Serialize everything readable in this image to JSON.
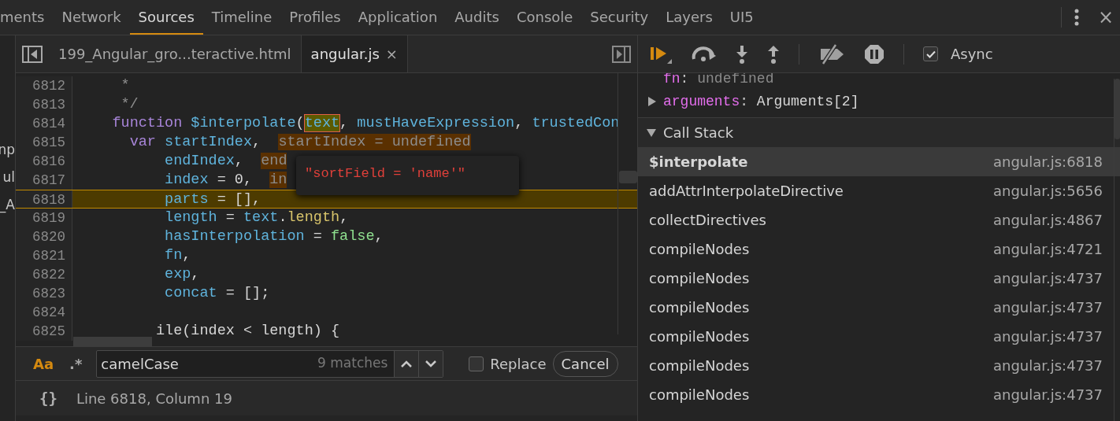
{
  "main_tabs": [
    {
      "label": "ments",
      "selected": false
    },
    {
      "label": "Network",
      "selected": false
    },
    {
      "label": "Sources",
      "selected": true
    },
    {
      "label": "Timeline",
      "selected": false
    },
    {
      "label": "Profiles",
      "selected": false
    },
    {
      "label": "Application",
      "selected": false
    },
    {
      "label": "Audits",
      "selected": false
    },
    {
      "label": "Console",
      "selected": false
    },
    {
      "label": "Security",
      "selected": false
    },
    {
      "label": "Layers",
      "selected": false
    },
    {
      "label": "UI5",
      "selected": false
    }
  ],
  "close_glyph": "×",
  "navigator_fragments": [
    "np",
    "ul",
    "_A"
  ],
  "file_tabs": [
    {
      "label": "199_Angular_gro...teractive.html",
      "selected": false,
      "closable": false
    },
    {
      "label": "angular.js",
      "selected": true,
      "closable": true,
      "close": "×"
    }
  ],
  "code_lines": [
    {
      "number": "6812",
      "current": false,
      "tokens": [
        {
          "kind": "comment",
          "text": "     *"
        }
      ]
    },
    {
      "number": "6813",
      "current": false,
      "tokens": [
        {
          "kind": "comment",
          "text": "     */"
        }
      ]
    },
    {
      "number": "6814",
      "current": false,
      "tokens": [
        {
          "kind": "keyword",
          "text": "    function "
        },
        {
          "kind": "ident",
          "text": "$interpolate"
        },
        {
          "kind": "plain",
          "text": "("
        },
        {
          "kind": "match",
          "text": "text"
        },
        {
          "kind": "plain",
          "text": ", "
        },
        {
          "kind": "ident",
          "text": "mustHaveExpression"
        },
        {
          "kind": "plain",
          "text": ", "
        },
        {
          "kind": "ident",
          "text": "trustedCon"
        }
      ]
    },
    {
      "number": "6815",
      "current": false,
      "tokens": [
        {
          "kind": "keyword",
          "text": "      var "
        },
        {
          "kind": "ident",
          "text": "startIndex"
        },
        {
          "kind": "plain",
          "text": ",  "
        },
        {
          "kind": "hint",
          "text": "startIndex = undefined"
        }
      ]
    },
    {
      "number": "6816",
      "current": false,
      "tokens": [
        {
          "kind": "ident",
          "text": "          endIndex"
        },
        {
          "kind": "plain",
          "text": ",  "
        },
        {
          "kind": "hint",
          "text": "end"
        }
      ]
    },
    {
      "number": "6817",
      "current": false,
      "tokens": [
        {
          "kind": "ident",
          "text": "          index"
        },
        {
          "kind": "plain",
          "text": " = 0,  "
        },
        {
          "kind": "hint",
          "text": "in"
        }
      ]
    },
    {
      "number": "6818",
      "current": true,
      "tokens": [
        {
          "kind": "ident",
          "text": "          parts"
        },
        {
          "kind": "plain",
          "text": " = [],"
        }
      ]
    },
    {
      "number": "6819",
      "current": false,
      "tokens": [
        {
          "kind": "ident",
          "text": "          length"
        },
        {
          "kind": "plain",
          "text": " = "
        },
        {
          "kind": "ident",
          "text": "text"
        },
        {
          "kind": "plain",
          "text": "."
        },
        {
          "kind": "property",
          "text": "length"
        },
        {
          "kind": "plain",
          "text": ","
        }
      ]
    },
    {
      "number": "6820",
      "current": false,
      "tokens": [
        {
          "kind": "ident",
          "text": "          hasInterpolation"
        },
        {
          "kind": "plain",
          "text": " = "
        },
        {
          "kind": "literal",
          "text": "false"
        },
        {
          "kind": "plain",
          "text": ","
        }
      ]
    },
    {
      "number": "6821",
      "current": false,
      "tokens": [
        {
          "kind": "ident",
          "text": "          fn"
        },
        {
          "kind": "plain",
          "text": ","
        }
      ]
    },
    {
      "number": "6822",
      "current": false,
      "tokens": [
        {
          "kind": "ident",
          "text": "          exp"
        },
        {
          "kind": "plain",
          "text": ","
        }
      ]
    },
    {
      "number": "6823",
      "current": false,
      "tokens": [
        {
          "kind": "ident",
          "text": "          concat"
        },
        {
          "kind": "plain",
          "text": " = [];"
        }
      ]
    },
    {
      "number": "6824",
      "current": false
    },
    {
      "number": "6825",
      "current": false,
      "tokens": [
        {
          "kind": "plain",
          "text": "         ile(index < length) {"
        }
      ]
    }
  ],
  "tooltip": {
    "text": "\"sortField = 'name'\""
  },
  "search": {
    "case_label": "Aa",
    "case_on": true,
    "regex_label": ".*",
    "regex_on": false,
    "value": "camelCase",
    "matches": "9 matches",
    "replace_label": "Replace",
    "replace_checked": false,
    "cancel": "Cancel"
  },
  "status_bar": {
    "pretty": "{}",
    "position": "Line 6818, Column 19"
  },
  "debug_toolbar": {
    "async_label": "Async",
    "async_checked": true
  },
  "scope": [
    {
      "name": "fn",
      "colon": ":",
      "value": "undefined",
      "kind": "undefined"
    },
    {
      "name": "arguments",
      "colon": ":",
      "value": "Arguments[2]",
      "kind": "object",
      "expanded": false
    }
  ],
  "call_stack": {
    "title": "Call Stack",
    "expanded": true,
    "frames": [
      {
        "name": "$interpolate",
        "location": "angular.js:6818",
        "selected": true
      },
      {
        "name": "addAttrInterpolateDirective",
        "location": "angular.js:5656",
        "selected": false
      },
      {
        "name": "collectDirectives",
        "location": "angular.js:4867",
        "selected": false
      },
      {
        "name": "compileNodes",
        "location": "angular.js:4721",
        "selected": false
      },
      {
        "name": "compileNodes",
        "location": "angular.js:4737",
        "selected": false
      },
      {
        "name": "compileNodes",
        "location": "angular.js:4737",
        "selected": false
      },
      {
        "name": "compileNodes",
        "location": "angular.js:4737",
        "selected": false
      },
      {
        "name": "compileNodes",
        "location": "angular.js:4737",
        "selected": false
      },
      {
        "name": "compileNodes",
        "location": "angular.js:4737",
        "selected": false
      }
    ]
  }
}
